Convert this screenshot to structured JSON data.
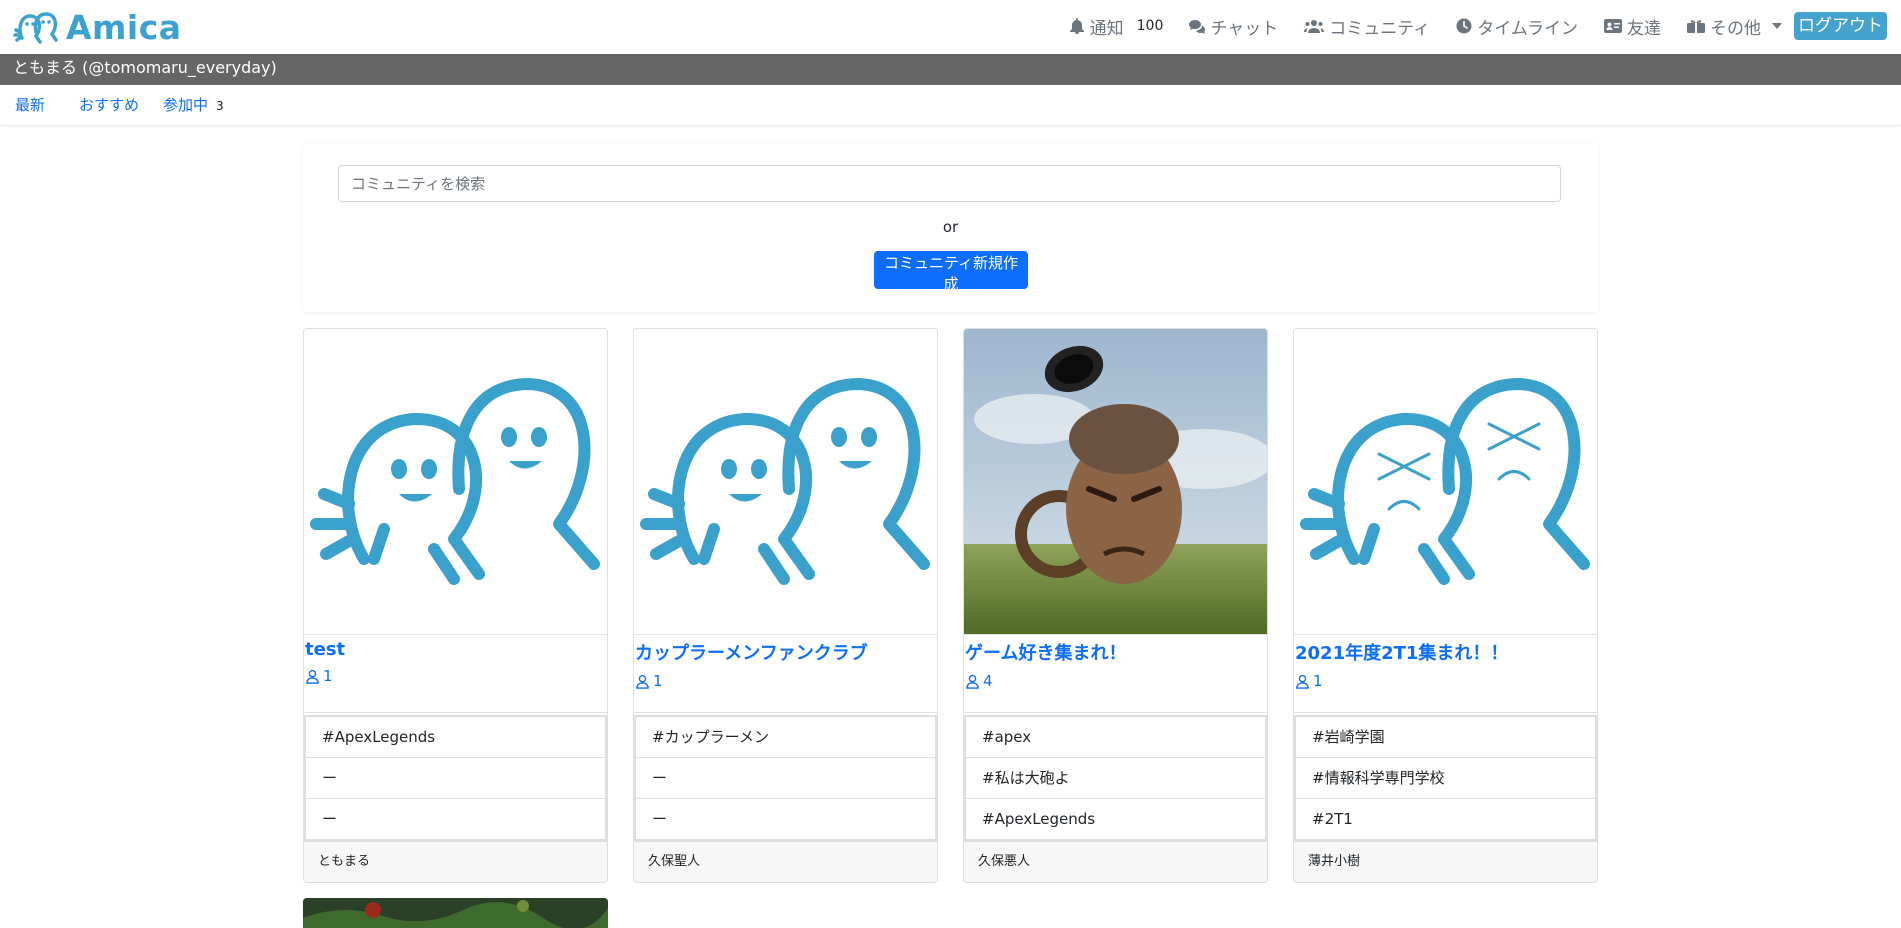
{
  "brand": {
    "name": "Amica"
  },
  "nav": {
    "notifications_label": "通知",
    "notifications_count": "100",
    "chat_label": "チャット",
    "community_label": "コミュニティ",
    "timeline_label": "タイムライン",
    "friends_label": "友達",
    "other_label": "その他",
    "logout_label": "ログアウト"
  },
  "user": {
    "display": "ともまる (@tomomaru_everyday)"
  },
  "tabs": {
    "latest": "最新",
    "recommended": "おすすめ",
    "joined": "参加中",
    "joined_count": "3"
  },
  "search": {
    "placeholder": "コミュニティを検索",
    "or_text": "or",
    "create_label": "コミュニティ新規作成"
  },
  "communities": [
    {
      "title": "test",
      "members": "1",
      "tags": [
        "#ApexLegends",
        "ー",
        "ー"
      ],
      "owner": "ともまる",
      "image": "amica-mascot"
    },
    {
      "title": "カップラーメンファンクラブ",
      "members": "1",
      "tags": [
        "#カップラーメン",
        "ー",
        "ー"
      ],
      "owner": "久保聖人",
      "image": "amica-mascot"
    },
    {
      "title": "ゲーム好き集まれ！",
      "members": "4",
      "tags": [
        "#apex",
        "#私は大砲よ",
        "#ApexLegends"
      ],
      "owner": "久保悪人",
      "image": "cannon-head-photo"
    },
    {
      "title": "2021年度2T1集まれ！！",
      "members": "1",
      "tags": [
        "#岩崎学園",
        "#情報科学専門学校",
        "#2T1"
      ],
      "owner": "薄井小樹",
      "image": "amica-mascot-sad"
    }
  ],
  "colors": {
    "brand": "#3ba1cf",
    "link": "#0d6efd",
    "userbar": "#666666",
    "logout": "#45a2cf"
  }
}
